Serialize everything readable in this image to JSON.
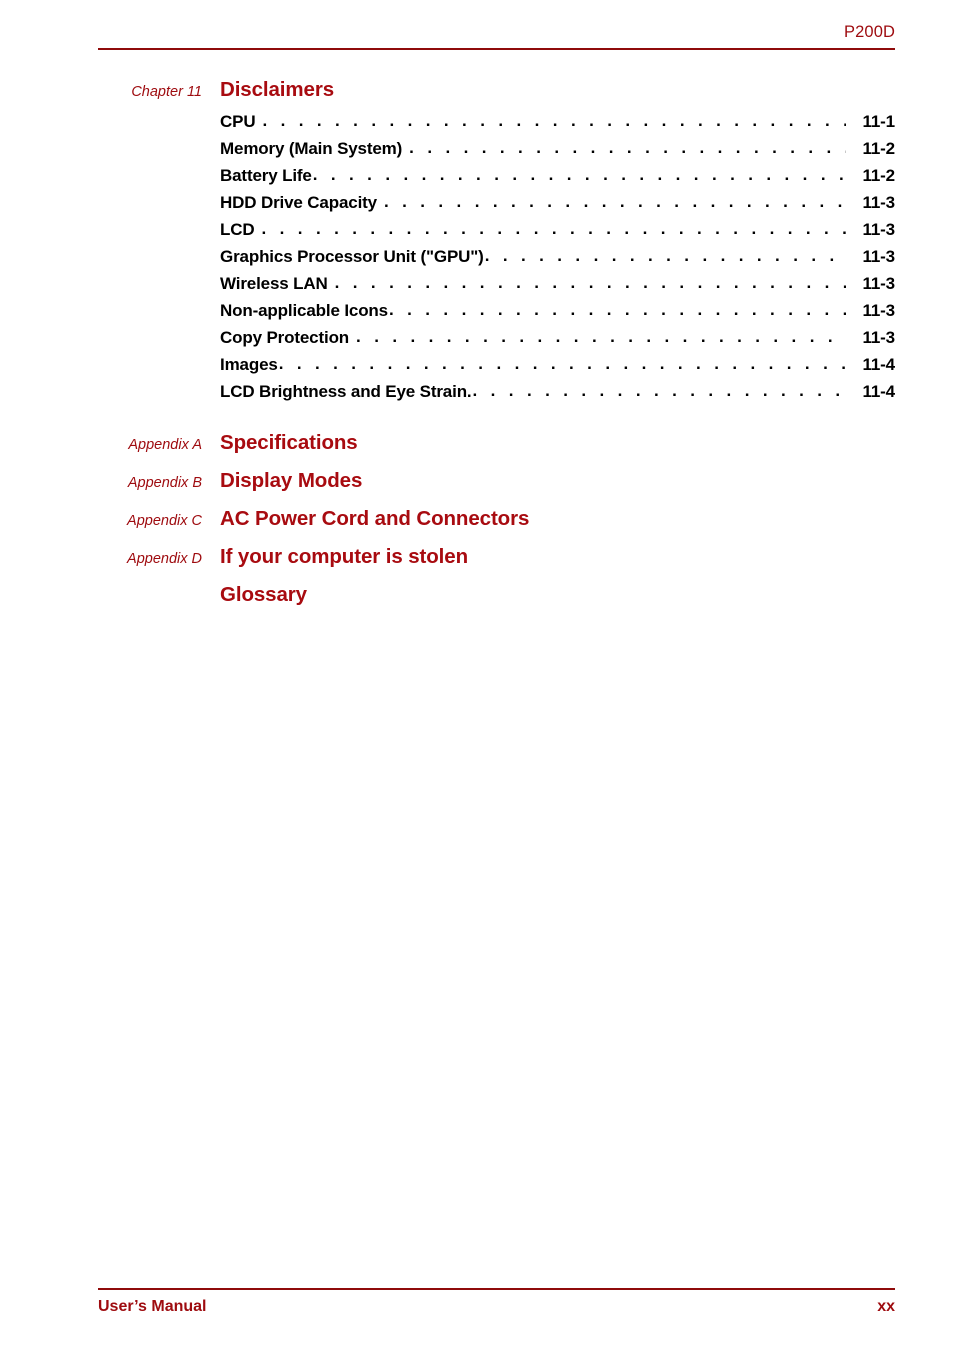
{
  "header": {
    "doc_model": "P200D"
  },
  "colors": {
    "brand_red": "#a80b10",
    "rule_red": "#8f0b0b",
    "header_text_red": "#9e0b0f",
    "entry_text": "#000000"
  },
  "chapter": {
    "label": "Chapter 11",
    "title": "Disclaimers",
    "entries": [
      {
        "text": "CPU",
        "page": "11-1",
        "gap": "wide"
      },
      {
        "text": "Memory (Main System)",
        "page": "11-2",
        "gap": "wide"
      },
      {
        "text": "Battery Life",
        "page": "11-2",
        "gap": "narrow"
      },
      {
        "text": "HDD Drive Capacity",
        "page": "11-3",
        "gap": "wide"
      },
      {
        "text": "LCD",
        "page": "11-3",
        "gap": "wide"
      },
      {
        "text": "Graphics Processor Unit (\"GPU\")",
        "page": "11-3",
        "gap": "narrow"
      },
      {
        "text": "Wireless LAN",
        "page": "11-3",
        "gap": "wide"
      },
      {
        "text": "Non-applicable Icons",
        "page": "11-3",
        "gap": "narrow"
      },
      {
        "text": "Copy Protection",
        "page": "11-3",
        "gap": "wide"
      },
      {
        "text": "Images",
        "page": "11-4",
        "gap": "narrow"
      },
      {
        "text": "LCD Brightness and Eye Strain.",
        "page": "11-4",
        "gap": "narrow"
      }
    ]
  },
  "appendices": [
    {
      "label": "Appendix A",
      "title": "Specifications"
    },
    {
      "label": "Appendix B",
      "title": "Display Modes"
    },
    {
      "label": "Appendix C",
      "title": "AC Power Cord and Connectors"
    },
    {
      "label": "Appendix D",
      "title": "If your computer is stolen"
    },
    {
      "label": "",
      "title": "Glossary"
    }
  ],
  "footer": {
    "manual_label": "User’s Manual",
    "page_number": "xx"
  },
  "leader_dots": ". . . . . . . . . . . . . . . . . . . . . . . . . . . . . . . . . . . . . . . . . . . . . . . . . . . . . . . . . . . . . . . . . . . . . . . ."
}
